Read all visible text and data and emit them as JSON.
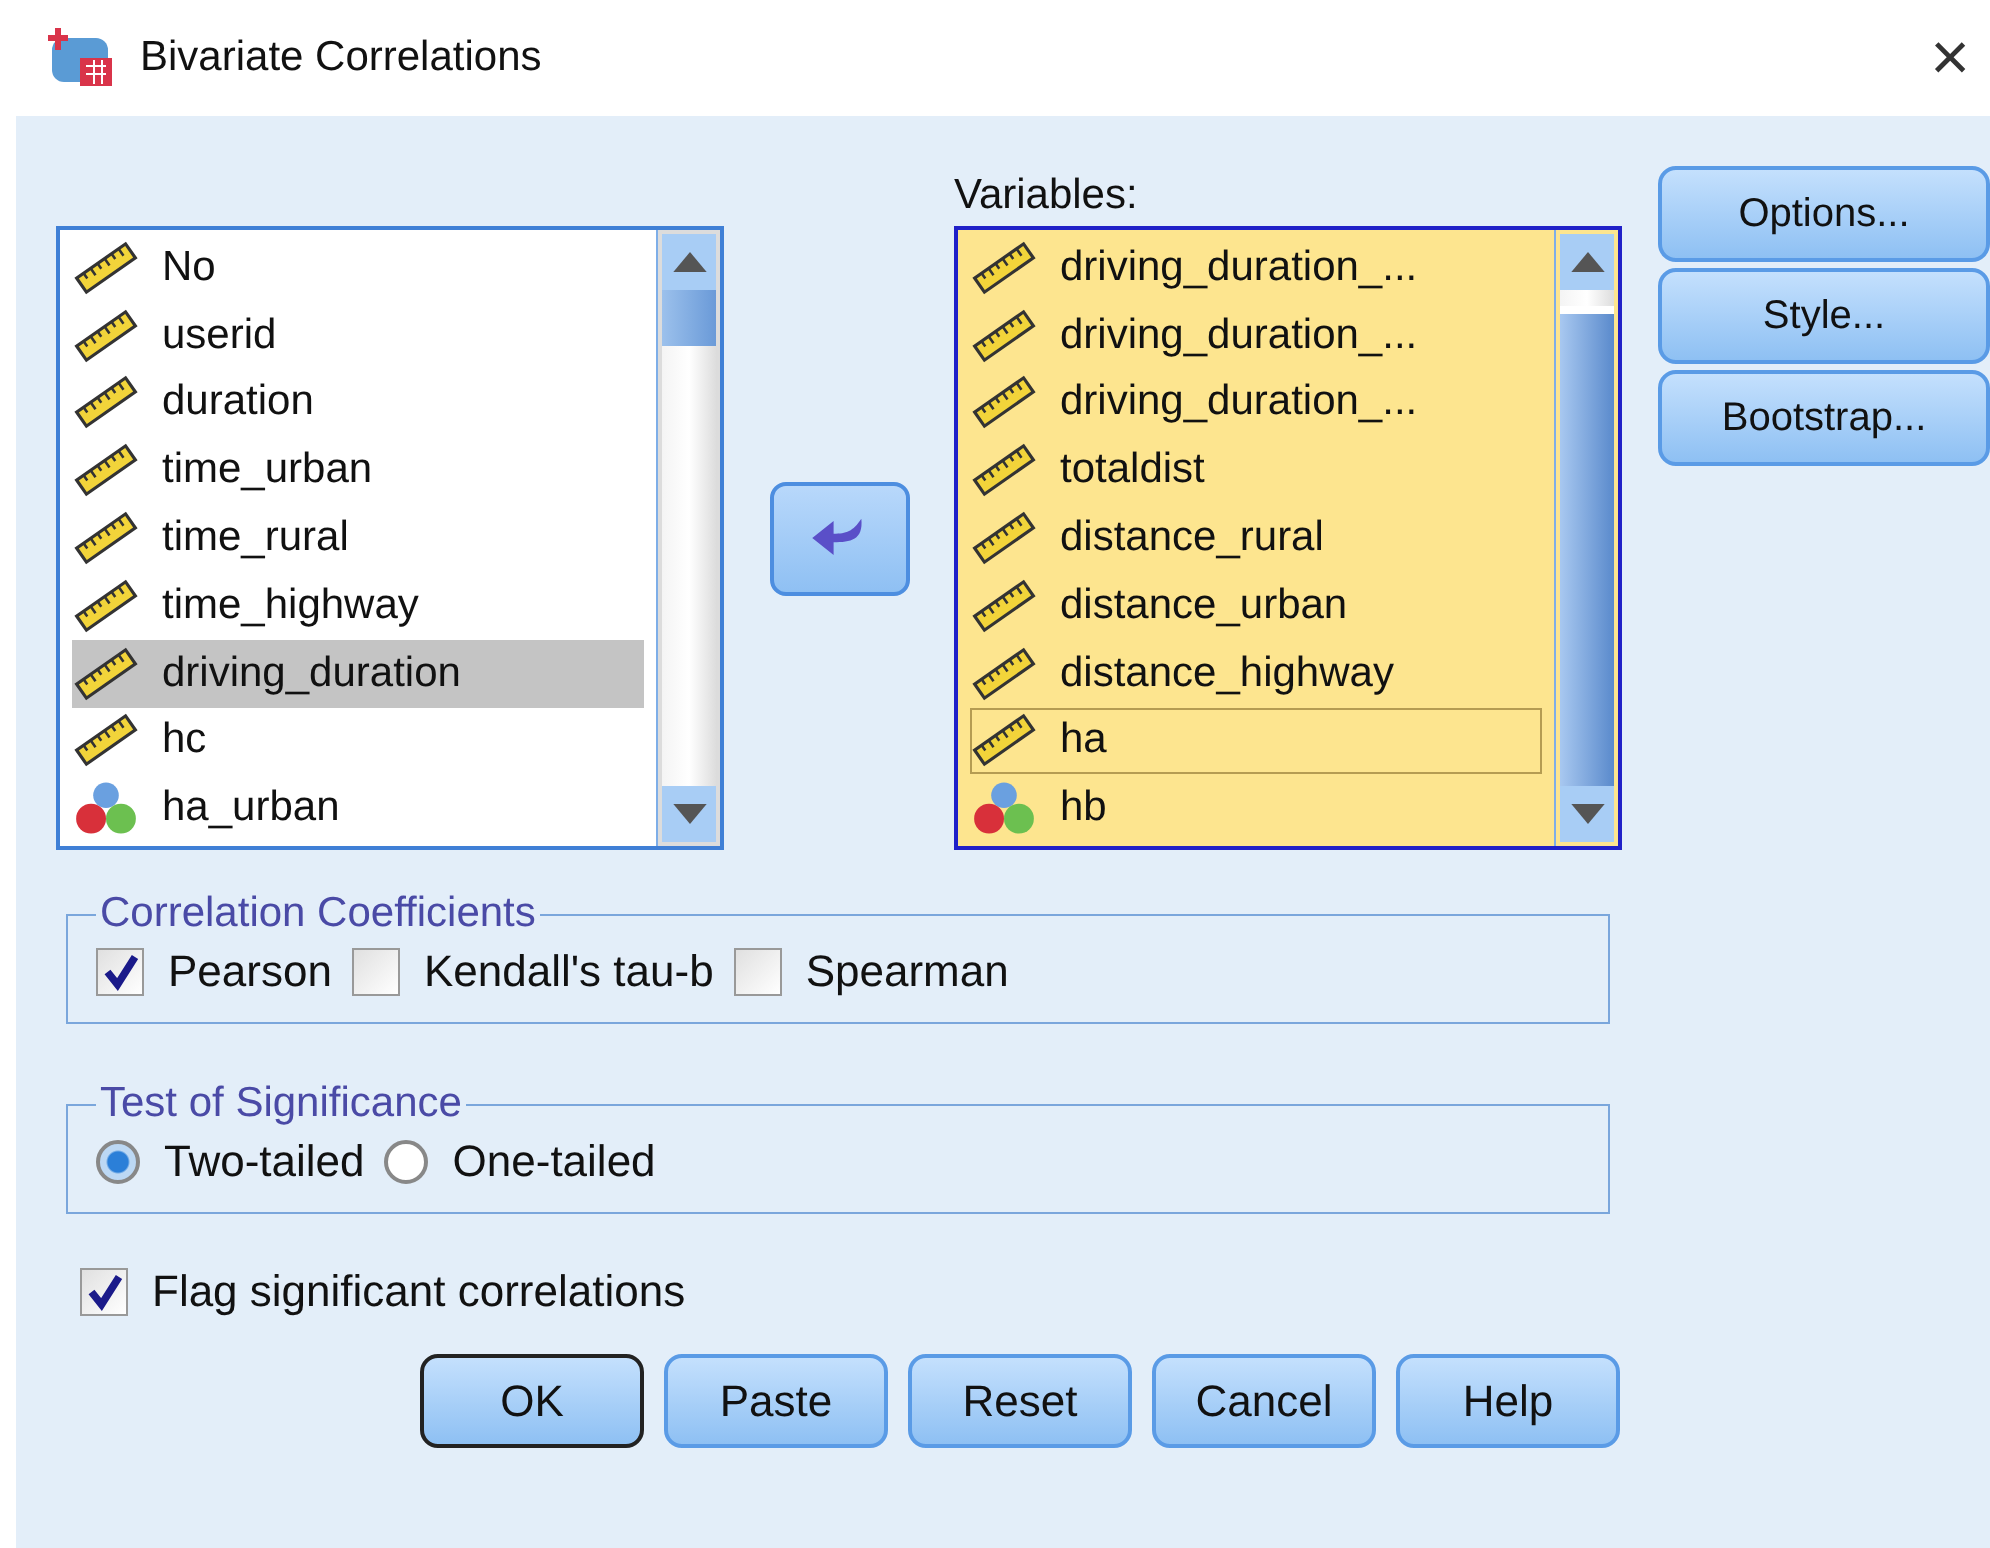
{
  "window": {
    "title": "Bivariate Correlations",
    "close": "×"
  },
  "source_list": {
    "items": [
      {
        "label": "No",
        "kind": "scale",
        "selected": false
      },
      {
        "label": "userid",
        "kind": "scale",
        "selected": false
      },
      {
        "label": "duration",
        "kind": "scale",
        "selected": false
      },
      {
        "label": "time_urban",
        "kind": "scale",
        "selected": false
      },
      {
        "label": "time_rural",
        "kind": "scale",
        "selected": false
      },
      {
        "label": "time_highway",
        "kind": "scale",
        "selected": false
      },
      {
        "label": "driving_duration",
        "kind": "scale",
        "selected": true
      },
      {
        "label": "hc",
        "kind": "scale",
        "selected": false
      },
      {
        "label": "ha_urban",
        "kind": "nominal",
        "selected": false
      }
    ]
  },
  "variables": {
    "label": "Variables:",
    "items": [
      {
        "label": "driving_duration_...",
        "kind": "scale",
        "focused": false
      },
      {
        "label": "driving_duration_...",
        "kind": "scale",
        "focused": false
      },
      {
        "label": "driving_duration_...",
        "kind": "scale",
        "focused": false
      },
      {
        "label": "totaldist",
        "kind": "scale",
        "focused": false
      },
      {
        "label": "distance_rural",
        "kind": "scale",
        "focused": false
      },
      {
        "label": "distance_urban",
        "kind": "scale",
        "focused": false
      },
      {
        "label": "distance_highway",
        "kind": "scale",
        "focused": false
      },
      {
        "label": "ha",
        "kind": "scale",
        "focused": true
      },
      {
        "label": "hb",
        "kind": "nominal",
        "focused": false
      }
    ]
  },
  "side_buttons": [
    "Options...",
    "Style...",
    "Bootstrap..."
  ],
  "coefficients": {
    "title": "Correlation Coefficients",
    "options": [
      {
        "label": "Pearson",
        "checked": true
      },
      {
        "label": "Kendall's tau-b",
        "checked": false
      },
      {
        "label": "Spearman",
        "checked": false
      }
    ]
  },
  "significance": {
    "title": "Test of Significance",
    "options": [
      {
        "label": "Two-tailed",
        "selected": true
      },
      {
        "label": "One-tailed",
        "selected": false
      }
    ]
  },
  "flag": {
    "label": "Flag significant correlations",
    "checked": true
  },
  "buttons": [
    {
      "label": "OK",
      "default": true
    },
    {
      "label": "Paste",
      "default": false
    },
    {
      "label": "Reset",
      "default": false
    },
    {
      "label": "Cancel",
      "default": false
    },
    {
      "label": "Help",
      "default": false
    }
  ]
}
